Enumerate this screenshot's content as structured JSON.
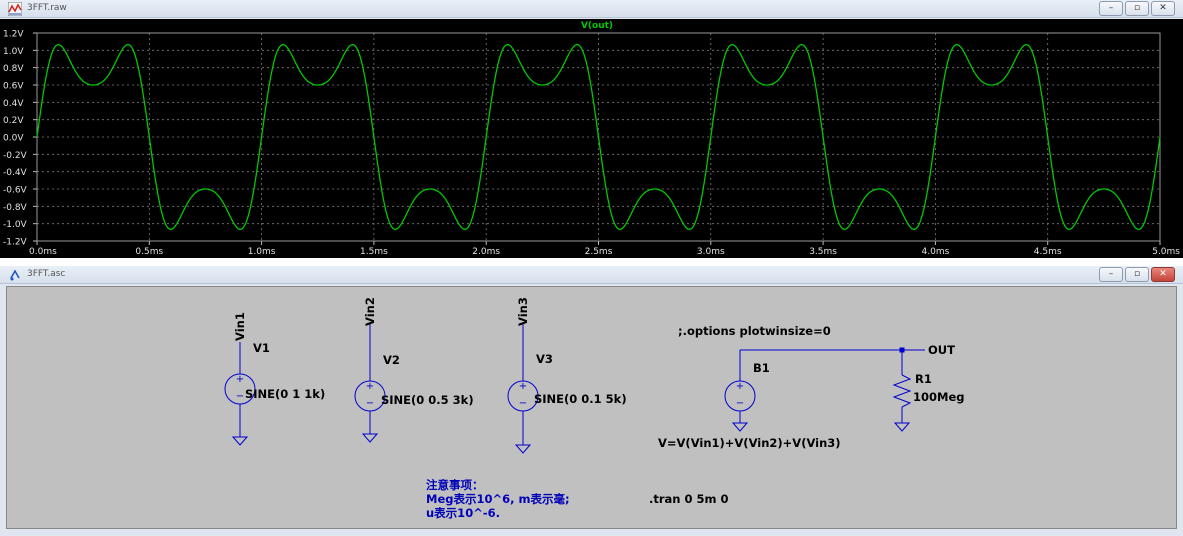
{
  "plot_window": {
    "title": "3FFT.raw",
    "trace_label": "V(out)",
    "trace_color": "#00c800",
    "y_ticks": [
      "1.2V",
      "1.0V",
      "0.8V",
      "0.6V",
      "0.4V",
      "0.2V",
      "0.0V",
      "-0.2V",
      "-0.4V",
      "-0.6V",
      "-0.8V",
      "-1.0V",
      "-1.2V"
    ],
    "x_ticks": [
      "0.0ms",
      "0.5ms",
      "1.0ms",
      "1.5ms",
      "2.0ms",
      "2.5ms",
      "3.0ms",
      "3.5ms",
      "4.0ms",
      "4.5ms",
      "5.0ms"
    ]
  },
  "chart_data": {
    "type": "line",
    "title": "V(out)",
    "xlabel": "",
    "ylabel": "",
    "xlim": [
      0,
      5
    ],
    "ylim": [
      -1.2,
      1.2
    ],
    "x_unit": "ms",
    "grid": true,
    "series": [
      {
        "name": "V(out)",
        "expression": "sin(2π·1k·t) + 0.5·sin(2π·3k·t) + 0.1·sin(2π·5k·t)",
        "components": [
          {
            "amplitude": 1.0,
            "frequency_hz": 1000
          },
          {
            "amplitude": 0.5,
            "frequency_hz": 3000
          },
          {
            "amplitude": 0.1,
            "frequency_hz": 5000
          }
        ]
      }
    ]
  },
  "schematic_window": {
    "title": "3FFT.asc",
    "sources": [
      {
        "net": "Vin1",
        "name": "V1",
        "value": "SINE(0 1 1k)"
      },
      {
        "net": "Vin2",
        "name": "V2",
        "value": "SINE(0 0.5 3k)"
      },
      {
        "net": "Vin3",
        "name": "V3",
        "value": "SINE(0 0.1 5k)"
      }
    ],
    "behavioral": {
      "name": "B1",
      "value": "V=V(Vin1)+V(Vin2)+V(Vin3)"
    },
    "resistor": {
      "name": "R1",
      "value": "100Meg"
    },
    "out_label": "OUT",
    "options_directive": ";.options plotwinsize=0",
    "tran_directive": ".tran 0 5m 0",
    "note_lines": [
      "注意事项：",
      "Meg表示10^6, m表示毫;",
      "u表示10^-6."
    ]
  }
}
